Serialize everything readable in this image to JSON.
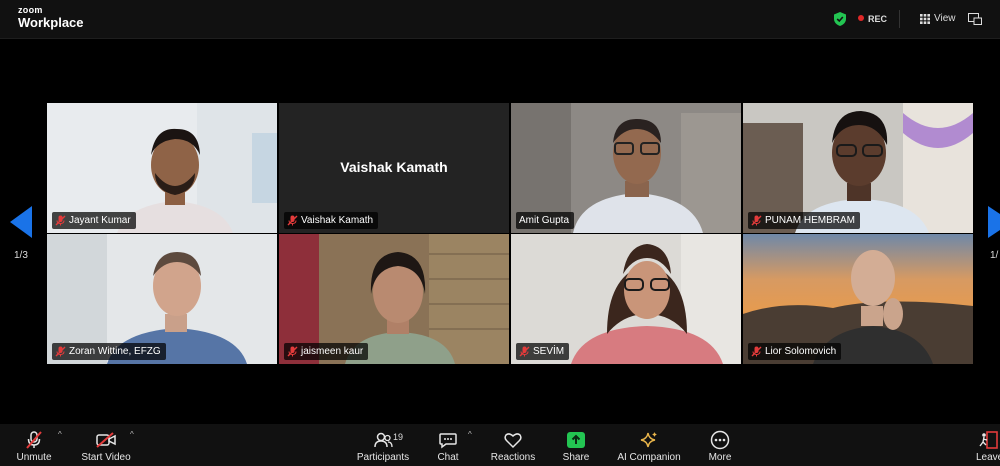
{
  "app": {
    "brand_small": "zoom",
    "brand_name": "Workplace"
  },
  "header": {
    "rec_label": "REC",
    "view_label": "View"
  },
  "pagination": {
    "left": "1/3",
    "right": "1/"
  },
  "participants": [
    {
      "name": "Jayant Kumar",
      "video": true
    },
    {
      "name": "Vaishak Kamath",
      "video": false,
      "display_name": "Vaishak Kamath"
    },
    {
      "name": "Amit Gupta",
      "video": true
    },
    {
      "name": "PUNAM HEMBRAM",
      "video": true
    },
    {
      "name": "Zoran Wittine, EFZG",
      "video": true
    },
    {
      "name": "jaismeen kaur",
      "video": true
    },
    {
      "name": "SEVİM",
      "video": true
    },
    {
      "name": "Lior Solomovich",
      "video": true
    }
  ],
  "toolbar": {
    "unmute": "Unmute",
    "start_video": "Start Video",
    "participants": "Participants",
    "participants_count": "19",
    "chat": "Chat",
    "reactions": "Reactions",
    "share": "Share",
    "ai_companion": "AI Companion",
    "more": "More",
    "leave": "Leave"
  },
  "colors": {
    "share_green": "#23c552",
    "rec_red": "#e02828",
    "nav_blue": "#1a73e8",
    "muted_red": "#e33b3b"
  }
}
